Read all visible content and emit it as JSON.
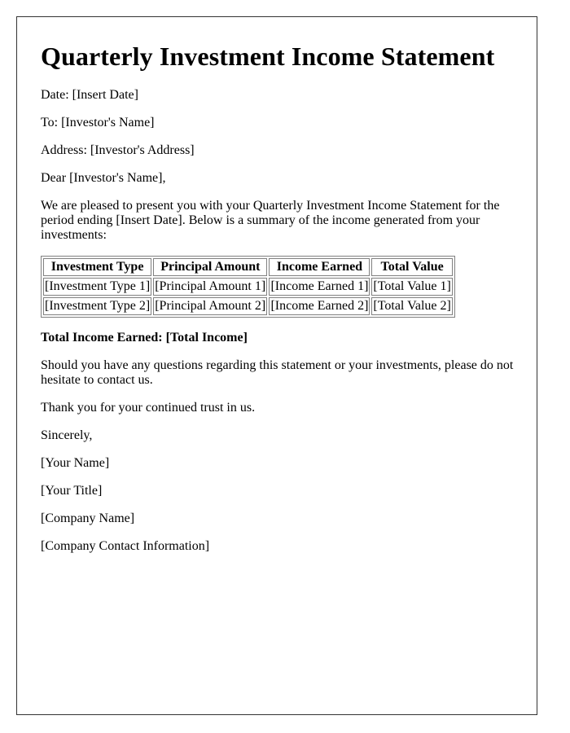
{
  "document": {
    "title": "Quarterly Investment Income Statement",
    "date_line": "Date: [Insert Date]",
    "to_line": "To: [Investor's Name]",
    "address_line": "Address: [Investor's Address]",
    "salutation": "Dear [Investor's Name],",
    "intro": "We are pleased to present you with your Quarterly Investment Income Statement for the period ending [Insert Date]. Below is a summary of the income generated from your investments:",
    "table": {
      "headers": [
        "Investment Type",
        "Principal Amount",
        "Income Earned",
        "Total Value"
      ],
      "rows": [
        [
          "[Investment Type 1]",
          "[Principal Amount 1]",
          "[Income Earned 1]",
          "[Total Value 1]"
        ],
        [
          "[Investment Type 2]",
          "[Principal Amount 2]",
          "[Income Earned 2]",
          "[Total Value 2]"
        ]
      ]
    },
    "total_income": "Total Income Earned: [Total Income]",
    "questions": "Should you have any questions regarding this statement or your investments, please do not hesitate to contact us.",
    "thanks": "Thank you for your continued trust in us.",
    "closing": "Sincerely,",
    "signature": {
      "name": "[Your Name]",
      "title": "[Your Title]",
      "company": "[Company Name]",
      "contact": "[Company Contact Information]"
    }
  }
}
